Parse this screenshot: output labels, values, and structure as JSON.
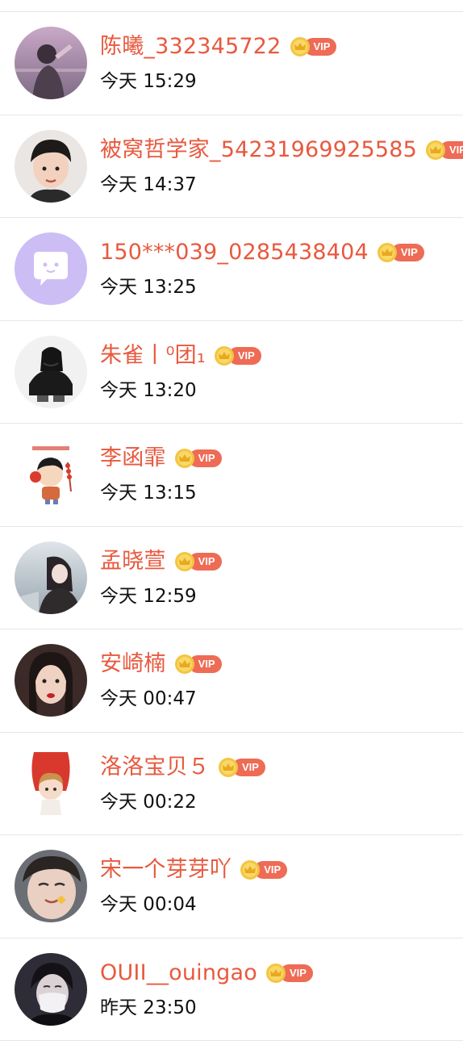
{
  "vip_label": "VIP",
  "colors": {
    "name": "#e8593e",
    "vip_badge": "#ee6b55",
    "crown": "#f4c542",
    "divider": "#e6e6e6",
    "time": "#111111"
  },
  "visitors": [
    {
      "name": "陈曦_332345722",
      "time": "今天 15:29",
      "avatar_icon": "girl-photo-avatar"
    },
    {
      "name": "被窝哲学家_54231969925585",
      "time": "今天 14:37",
      "avatar_icon": "boy-photo-avatar"
    },
    {
      "name": "150***039_0285438404",
      "time": "今天 13:25",
      "avatar_icon": "default-chat-bubble-avatar"
    },
    {
      "name": "朱雀丨⁰团₁",
      "time": "今天 13:20",
      "avatar_icon": "crouching-figure-avatar"
    },
    {
      "name": "李函霏",
      "time": "今天 13:15",
      "avatar_icon": "cartoon-child-avatar"
    },
    {
      "name": "孟晓萱",
      "time": "今天 12:59",
      "avatar_icon": "winter-girl-avatar"
    },
    {
      "name": "安崎楠",
      "time": "今天 00:47",
      "avatar_icon": "girl-portrait-avatar"
    },
    {
      "name": "洛洛宝贝５",
      "time": "今天 00:22",
      "avatar_icon": "cartoon-boy-red-avatar"
    },
    {
      "name": "宋一个芽芽吖",
      "time": "今天 00:04",
      "avatar_icon": "boy-closeup-avatar"
    },
    {
      "name": "OUII__ouingao",
      "time": "昨天 23:50",
      "avatar_icon": "masked-boy-avatar"
    }
  ]
}
